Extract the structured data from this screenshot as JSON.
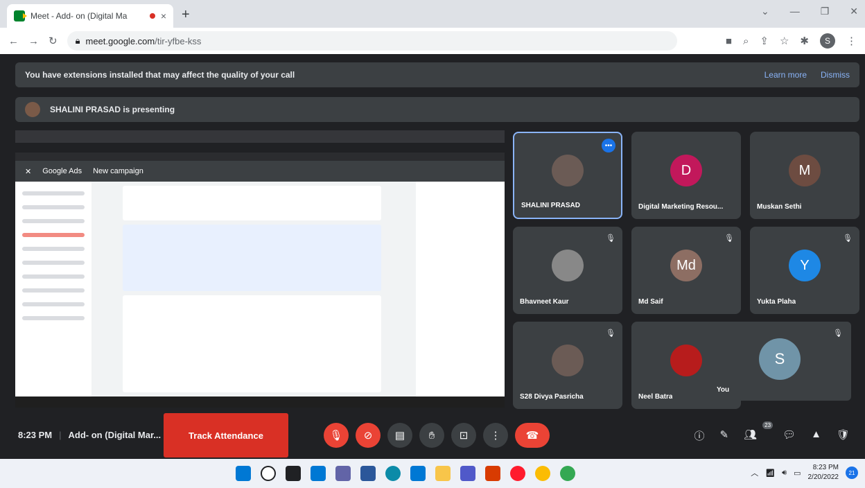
{
  "browser": {
    "tab_title": "Meet - Add- on (Digital Ma",
    "tab_close": "×",
    "new_tab": "+",
    "url_host": "meet.google.com",
    "url_path": "/tir-yfbe-kss",
    "profile_initial": "S"
  },
  "banner": {
    "text": "You have extensions installed that may affect the quality of your call",
    "learn_more": "Learn more",
    "dismiss": "Dismiss"
  },
  "presenting": {
    "text": "SHALINI PRASAD is presenting"
  },
  "shared_screen": {
    "app": "Google Ads",
    "page": "New campaign"
  },
  "participants": [
    {
      "name": "SHALINI PRASAD",
      "initial": "",
      "color": "#6b5b55"
    },
    {
      "name": "Digital Marketing Resou...",
      "initial": "D",
      "color": "#c2185b"
    },
    {
      "name": "Muskan Sethi",
      "initial": "M",
      "color": "#6d4c41"
    },
    {
      "name": "Bhavneet Kaur",
      "initial": "",
      "color": "#888888"
    },
    {
      "name": "Md Saif",
      "initial": "Md",
      "color": "#8d6e63"
    },
    {
      "name": "Yukta Plaha",
      "initial": "Y",
      "color": "#1e88e5"
    },
    {
      "name": "S28 Divya Pasricha",
      "initial": "",
      "color": "#6b5b55"
    },
    {
      "name": "Neel Batra",
      "initial": "",
      "color": "#b71c1c"
    }
  ],
  "self_view": {
    "name": "You",
    "initial": "S"
  },
  "bottom": {
    "time": "8:23 PM",
    "meeting_name": "Add- on (Digital Mar...",
    "track_attendance": "Track Attendance",
    "people_count": "23"
  },
  "taskbar": {
    "time": "8:23 PM",
    "date": "2/20/2022",
    "notifications": "21"
  }
}
